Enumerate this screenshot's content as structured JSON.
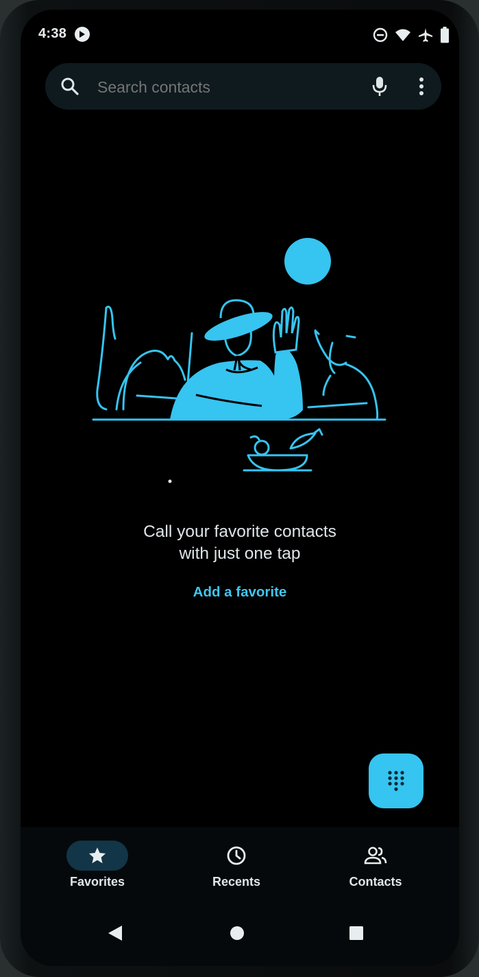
{
  "status_bar": {
    "time": "4:38",
    "icons": [
      "app-notification-icon",
      "do-not-disturb-icon",
      "wifi-icon",
      "airplane-mode-icon",
      "battery-icon"
    ]
  },
  "search": {
    "placeholder": "Search contacts"
  },
  "empty_state": {
    "title_line1": "Call your favorite contacts",
    "title_line2": "with just one tap",
    "action": "Add a favorite"
  },
  "bottom_nav": {
    "items": [
      {
        "label": "Favorites",
        "icon": "star-icon",
        "active": true
      },
      {
        "label": "Recents",
        "icon": "clock-icon",
        "active": false
      },
      {
        "label": "Contacts",
        "icon": "people-icon",
        "active": false
      }
    ]
  },
  "system_nav": [
    "back-icon",
    "home-icon",
    "recents-apps-icon"
  ],
  "colors": {
    "accent": "#36c4f0",
    "background": "#000000",
    "text": "#dfe6e8",
    "search_bg": "#0f1a1e",
    "active_pill": "#123547"
  }
}
